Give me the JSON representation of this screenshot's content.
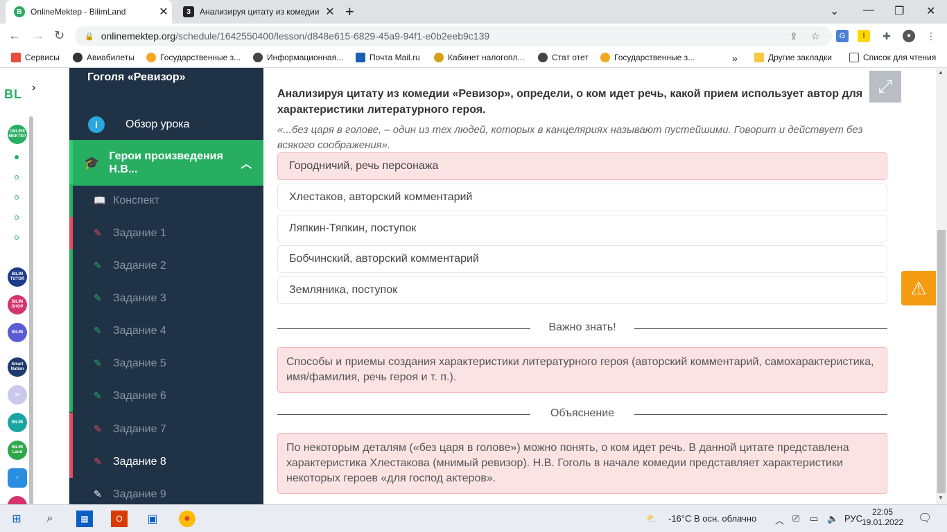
{
  "browser": {
    "tabs": [
      {
        "title": "OnlineMektep - BilimLand",
        "favicon": "B",
        "active": true
      },
      {
        "title": "Анализируя цитату из комедии",
        "favicon": "З",
        "active": false
      }
    ],
    "url_host": "onlinemektep.org",
    "url_path": "/schedule/1642550400/lesson/d848e615-6829-45a9-94f1-e0b2eeb9c139"
  },
  "bookmarks": {
    "items": [
      "Сервисы",
      "Авиабилеты",
      "Государственные з...",
      "Информационная...",
      "Почта Mail.ru",
      "Кабинет налогопл...",
      "Стат отет",
      "Государственные з..."
    ],
    "more": "»",
    "other": "Другие закладки",
    "reading_list": "Список для чтения"
  },
  "rail": {
    "logo": "BL",
    "arrow": "›"
  },
  "sidebar": {
    "top_title": "Гоголя «Ревизор»",
    "overview": "Обзор урока",
    "active_section": "Герои произведения Н.В...",
    "items": [
      {
        "label": "Конспект",
        "status": "green",
        "icon": "book-icon"
      },
      {
        "label": "Задание 1",
        "status": "red",
        "icon": "edit-icon"
      },
      {
        "label": "Задание 2",
        "status": "green",
        "icon": "edit-icon"
      },
      {
        "label": "Задание 3",
        "status": "green",
        "icon": "edit-icon"
      },
      {
        "label": "Задание 4",
        "status": "green",
        "icon": "edit-icon"
      },
      {
        "label": "Задание 5",
        "status": "green",
        "icon": "edit-icon"
      },
      {
        "label": "Задание 6",
        "status": "green",
        "icon": "edit-icon"
      },
      {
        "label": "Задание 7",
        "status": "red",
        "icon": "edit-icon"
      },
      {
        "label": "Задание 8",
        "status": "red",
        "icon": "edit-icon"
      },
      {
        "label": "Задание 9",
        "status": "none",
        "icon": "edit-icon"
      }
    ]
  },
  "task": {
    "question": "Анализируя цитату из комедии «Ревизор», определи, о ком идет речь, какой прием использует автор для характеристики литературного героя.",
    "quote": "«...без царя в голове, – один из тех людей, которых в канцеляриях называют пустейшими. Говорит и действует без всякого соображения».",
    "options": [
      "Городничий, речь персонажа",
      "Хлестаков, авторский комментарий",
      "Ляпкин-Тяпкин, поступок",
      "Бобчинский, авторский комментарий",
      "Земляника, поступок"
    ],
    "important_heading": "Важно знать!",
    "important_text": "Способы и приемы создания характеристики литературного героя (авторский комментарий, самохарактеристика, имя/фамилия, речь героя и т. п.).",
    "explanation_heading": "Объяснение",
    "explanation_text": "По некоторым деталям («без царя в голове») можно понять, о ком идет речь. В данной цитате представлена характеристика Хлестакова (мнимый ревизор). Н.В. Гоголь в начале комедии представляет характеристики некоторых героев «для господ актеров»."
  },
  "taskbar": {
    "weather": "-16°C  В осн. облачно",
    "lang": "РУС",
    "time": "22:05",
    "date": "19.01.2022"
  },
  "colors": {
    "green": "#27ae60",
    "red": "#e74c5c",
    "sidebar": "#1f3246",
    "accent_orange": "#f39c12"
  }
}
